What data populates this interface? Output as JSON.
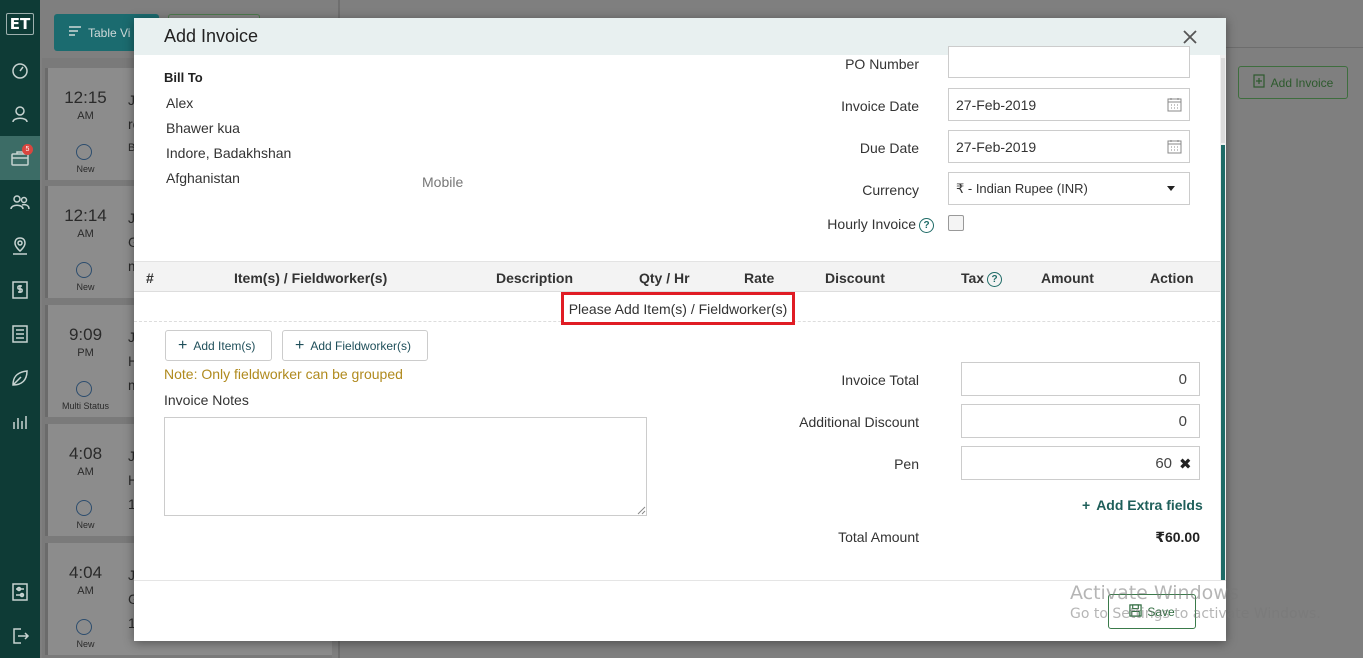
{
  "sidebar": {
    "logo": "ET",
    "badge_count": "5"
  },
  "background": {
    "table_view_label": "Table Vi",
    "add_invoice_label": "Add Invoice",
    "jobs": [
      {
        "time": "12:15",
        "ampm": "AM",
        "status": "New",
        "line1": "Ji",
        "line2": "re",
        "line3": "B"
      },
      {
        "time": "12:14",
        "ampm": "AM",
        "status": "New",
        "line1": "Ji",
        "line2": "G",
        "line3": "m"
      },
      {
        "time": "9:09",
        "ampm": "PM",
        "status": "Multi Status",
        "line1": "Ji",
        "line2": "H",
        "line3": "m"
      },
      {
        "time": "4:08",
        "ampm": "AM",
        "status": "New",
        "line1": "Ji",
        "line2": "H",
        "line3": "1"
      },
      {
        "time": "4:04",
        "ampm": "AM",
        "status": "New",
        "line1": "Ji",
        "line2": "G",
        "line3": "1"
      }
    ]
  },
  "modal": {
    "title": "Add Invoice",
    "bill_to": {
      "label": "Bill To",
      "name": "Alex",
      "address1": "Bhawer kua",
      "address2": "Indore, Badakhshan",
      "country": "Afghanistan",
      "mobile_label": "Mobile"
    },
    "fields": {
      "po_number_label": "PO Number",
      "po_number_value": "",
      "invoice_date_label": "Invoice Date",
      "invoice_date_value": "27-Feb-2019",
      "due_date_label": "Due Date",
      "due_date_value": "27-Feb-2019",
      "currency_label": "Currency",
      "currency_value": "₹ - Indian Rupee (INR)",
      "hourly_invoice_label": "Hourly Invoice",
      "hourly_invoice_checked": false
    },
    "table": {
      "columns": [
        "#",
        "Item(s) / Fieldworker(s)",
        "Description",
        "Qty / Hr",
        "Rate",
        "Discount",
        "Tax",
        "Amount",
        "Action"
      ],
      "empty_message": "Please Add Item(s) / Fieldworker(s)"
    },
    "actions": {
      "add_items_label": "Add Item(s)",
      "add_fieldworkers_label": "Add Fieldworker(s)",
      "note": "Note: Only fieldworker can be grouped"
    },
    "notes": {
      "label": "Invoice Notes",
      "value": ""
    },
    "totals": {
      "invoice_total_label": "Invoice Total",
      "invoice_total_value": "0",
      "additional_discount_label": "Additional Discount",
      "additional_discount_value": "0",
      "extra_field_label": "Pen",
      "extra_field_value": "60",
      "add_extra_fields_label": "Add Extra fields",
      "total_amount_label": "Total Amount",
      "total_amount_value": "₹60.00"
    },
    "save_label": "Save"
  },
  "watermark": {
    "line1": "Activate Windows",
    "line2": "Go to Settings to activate Windows."
  }
}
